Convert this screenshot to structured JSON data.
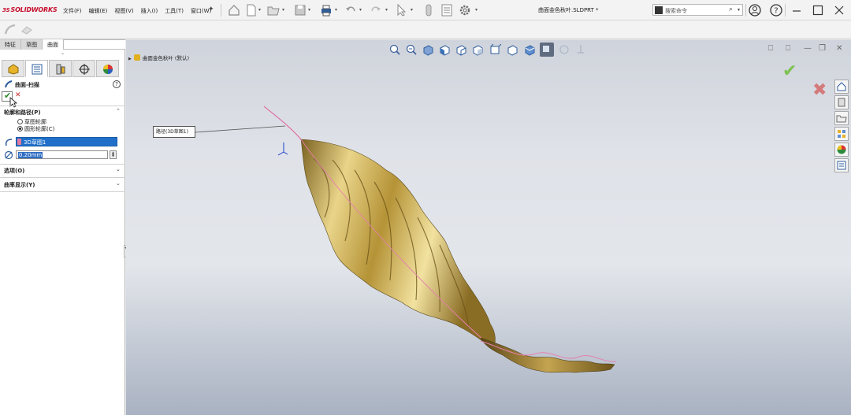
{
  "app": {
    "brand": "SOLIDWORKS",
    "brand_prefix": "3S",
    "document_title": "曲面金色秋叶.SLDPRT *"
  },
  "menu": {
    "items": [
      "文件(F)",
      "编辑(E)",
      "视图(V)",
      "插入(I)",
      "工具(T)",
      "窗口(W)"
    ]
  },
  "search": {
    "placeholder": "搜索命令"
  },
  "feature_manager": {
    "tabs": [
      "特征",
      "草图",
      "曲面"
    ],
    "active_tab": "曲面"
  },
  "property_manager": {
    "title": "曲面-扫描",
    "profile_section": {
      "heading": "轮廓和路径(P)",
      "options": [
        {
          "label": "草图轮廓",
          "selected": false
        },
        {
          "label": "圆形轮廓(C)",
          "selected": true
        }
      ],
      "path_value": "3D草图1",
      "diameter_value": "0.20mm"
    },
    "options_section": {
      "heading": "选项(O)"
    },
    "curvature_section": {
      "heading": "曲率显示(Y)"
    }
  },
  "viewport": {
    "tree_item": "曲面金色秋叶 (默认)",
    "callout_label": "路径(3D草图1)"
  },
  "colors": {
    "accent": "#1f6fc9",
    "brand": "#c8102e",
    "confirm": "#6fbf3a",
    "cancel": "#d46a6a",
    "leaf_gold": "#c9a84a"
  }
}
